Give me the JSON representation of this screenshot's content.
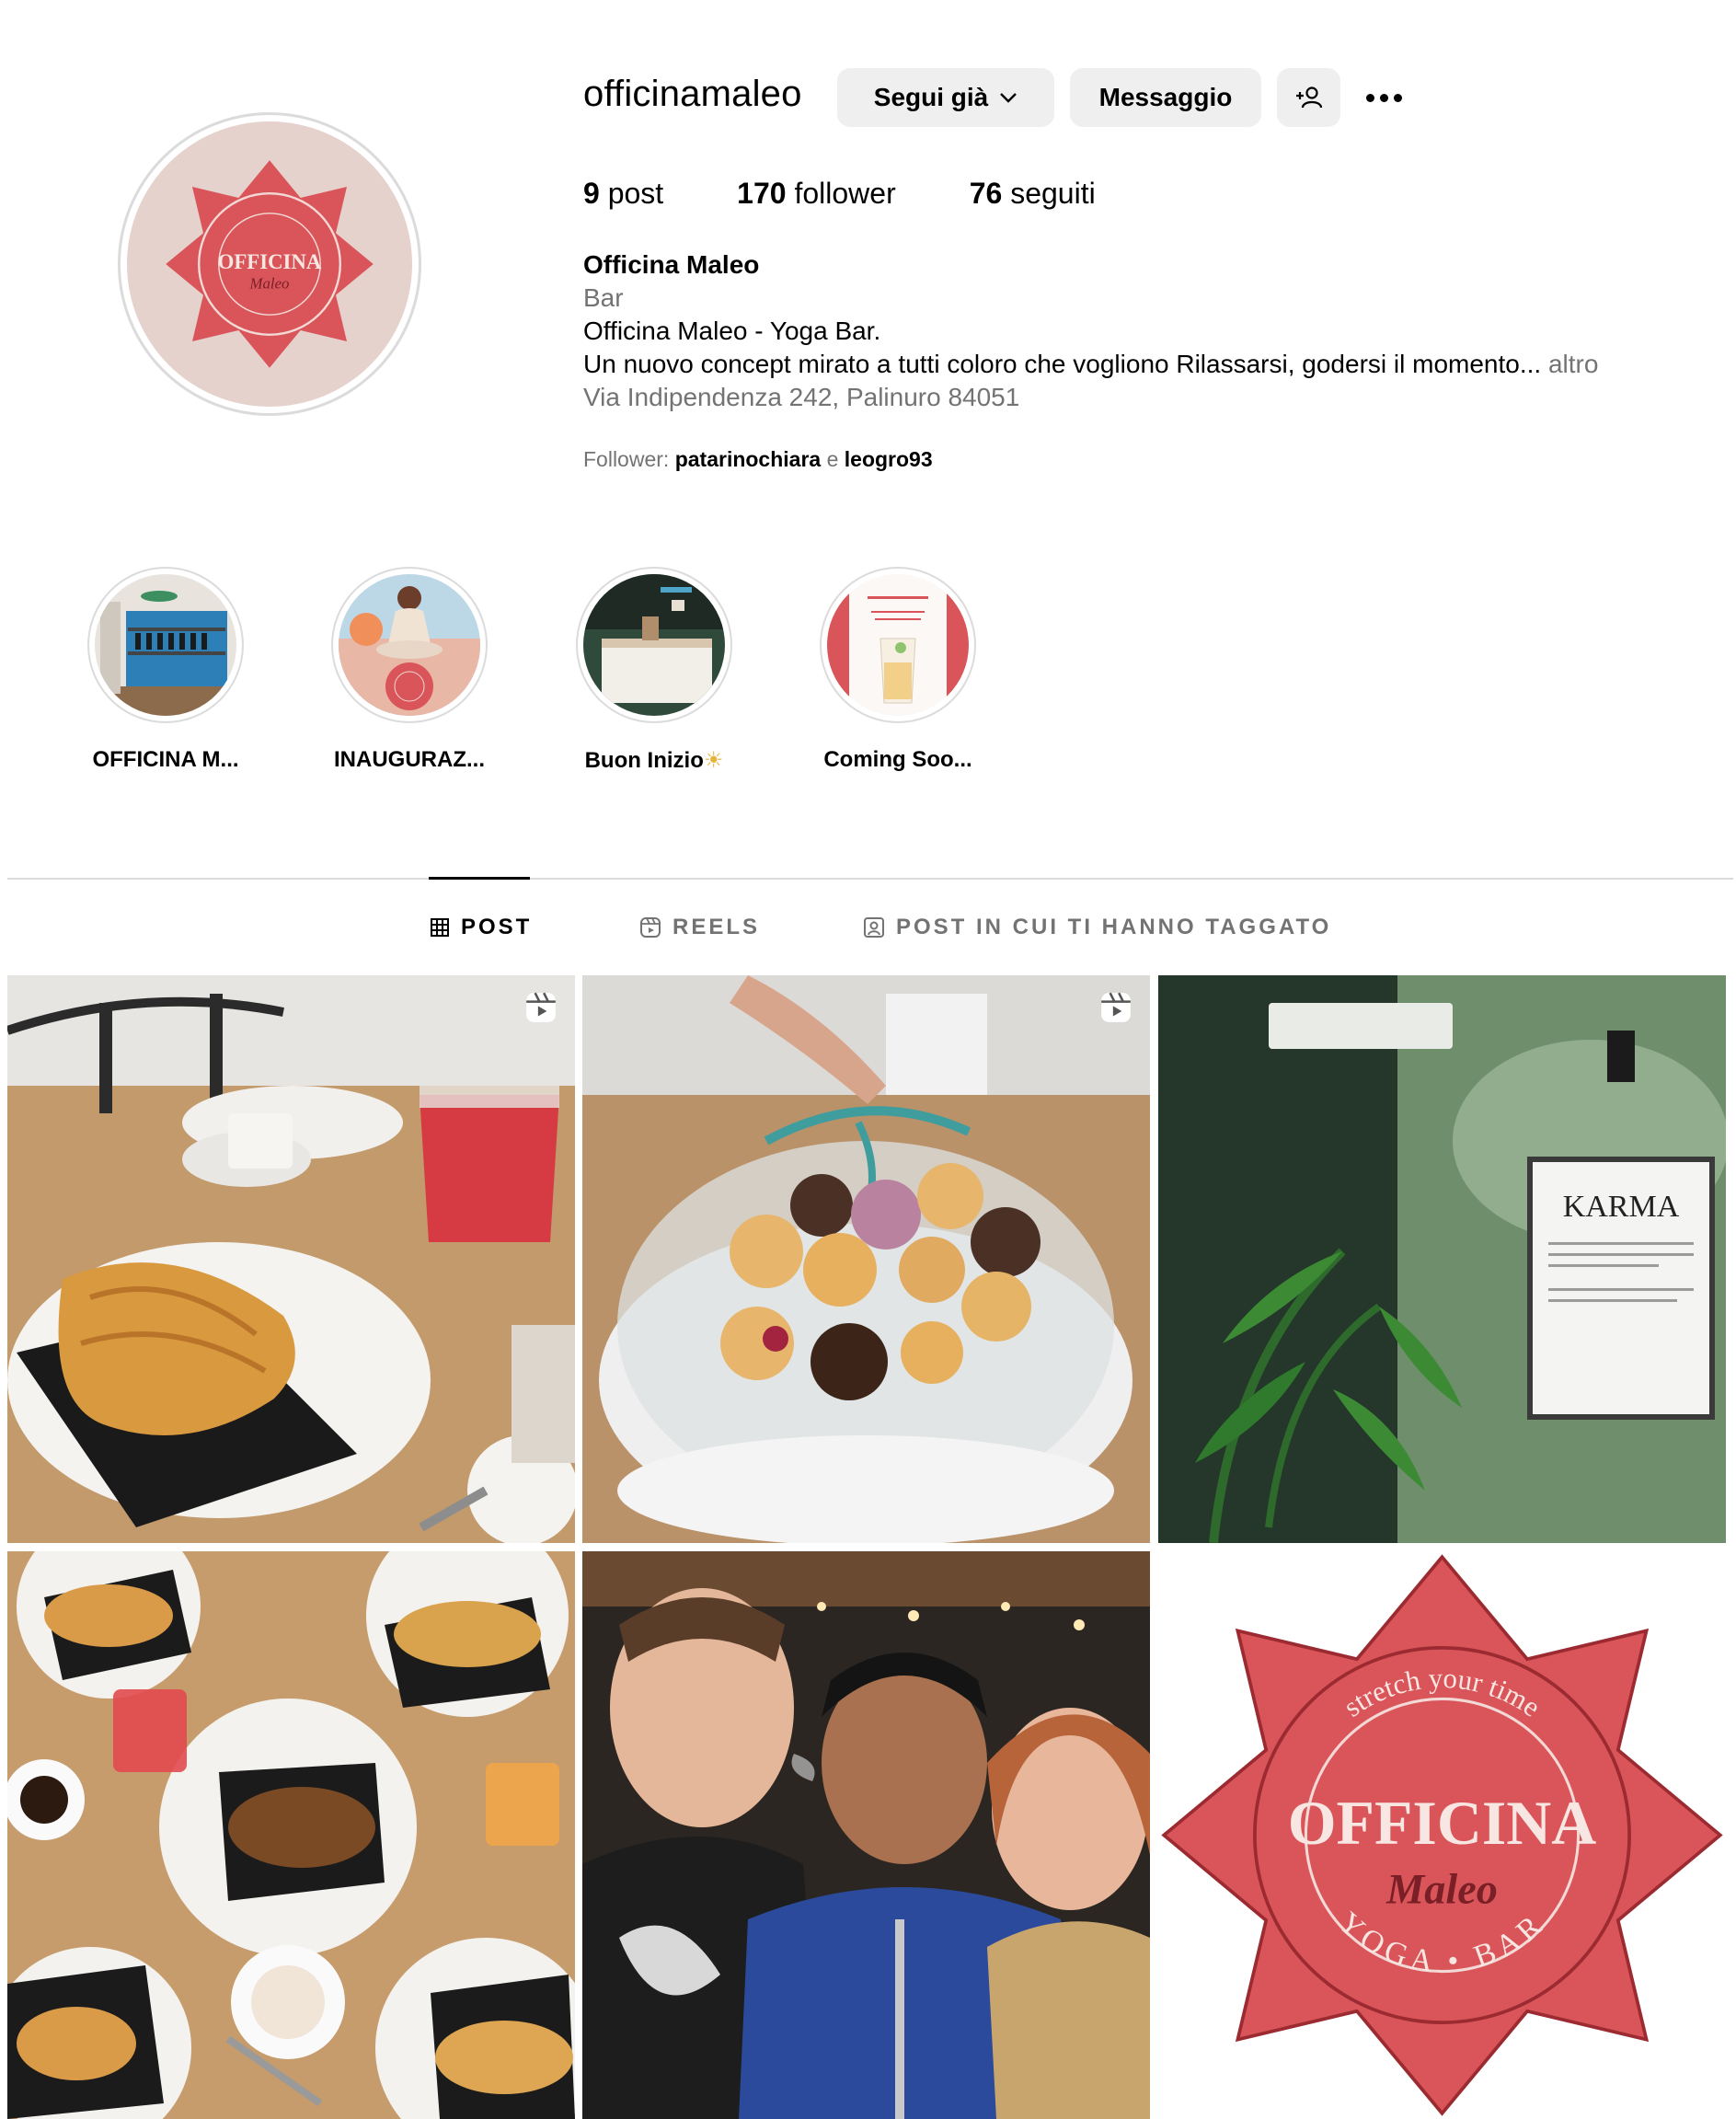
{
  "profile": {
    "username": "officinamaleo",
    "buttons": {
      "follow": "Segui già",
      "message": "Messaggio"
    },
    "stats": {
      "posts_count": "9",
      "posts_label": "post",
      "followers_count": "170",
      "followers_label": "follower",
      "following_count": "76",
      "following_label": "seguiti"
    },
    "bio": {
      "name": "Officina Maleo",
      "category": "Bar",
      "line1": "Officina Maleo - Yoga Bar.",
      "line2": "Un nuovo concept mirato a tutti coloro che vogliono Rilassarsi, godersi il momento...",
      "more": "altro",
      "address": "Via Indipendenza 242, Palinuro 84051"
    },
    "followed_by": {
      "prefix": "Follower:",
      "user1": "patarinochiara",
      "conj": "e",
      "user2": "leogro93"
    }
  },
  "logo": {
    "tagline": "stretch your time",
    "title": "OFFICINA",
    "script": "Maleo",
    "bottom": "YOGA • BAR"
  },
  "highlights": [
    {
      "label": "OFFICINA M..."
    },
    {
      "label": "INAUGURAZ..."
    },
    {
      "label": "Buon Inizio"
    },
    {
      "label": "Coming Soo..."
    }
  ],
  "tabs": [
    {
      "label": "POST",
      "active": true
    },
    {
      "label": "REELS",
      "active": false
    },
    {
      "label": "POST IN CUI TI HANNO TAGGATO",
      "active": false
    }
  ],
  "karma_sign": "KARMA",
  "colors": {
    "brand_red": "#d9555a",
    "brand_dark": "#b23b41",
    "button_bg": "#efefef",
    "muted": "#737373",
    "avatar_bg": "#e5d2cd"
  }
}
